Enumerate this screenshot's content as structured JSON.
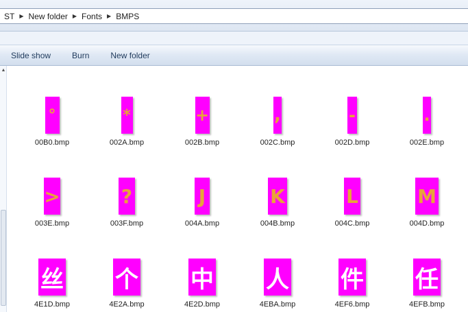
{
  "breadcrumb": [
    "ST",
    "New folder",
    "Fonts",
    "BMPS"
  ],
  "toolbar": {
    "slideshow": "Slide show",
    "burn": "Burn",
    "new_folder": "New folder"
  },
  "files": [
    {
      "name": "00B0.bmp",
      "glyph": "°"
    },
    {
      "name": "002A.bmp",
      "glyph": "*"
    },
    {
      "name": "002B.bmp",
      "glyph": "+"
    },
    {
      "name": "002C.bmp",
      "glyph": ","
    },
    {
      "name": "002D.bmp",
      "glyph": "-"
    },
    {
      "name": "002E.bmp",
      "glyph": "."
    },
    {
      "name": "003E.bmp",
      "glyph": ">"
    },
    {
      "name": "003F.bmp",
      "glyph": "?"
    },
    {
      "name": "004A.bmp",
      "glyph": "J"
    },
    {
      "name": "004B.bmp",
      "glyph": "K"
    },
    {
      "name": "004C.bmp",
      "glyph": "L"
    },
    {
      "name": "004D.bmp",
      "glyph": "M"
    },
    {
      "name": "4E1D.bmp",
      "glyph": "丝"
    },
    {
      "name": "4E2A.bmp",
      "glyph": "个"
    },
    {
      "name": "4E2D.bmp",
      "glyph": "中"
    },
    {
      "name": "4EBA.bmp",
      "glyph": "人"
    },
    {
      "name": "4EF6.bmp",
      "glyph": "件"
    },
    {
      "name": "4EFB.bmp",
      "glyph": "任"
    }
  ],
  "colors": {
    "tile_bg": "#ff00ff",
    "glyph_orange": "#e8a33a",
    "glyph_white": "#ffffff"
  }
}
